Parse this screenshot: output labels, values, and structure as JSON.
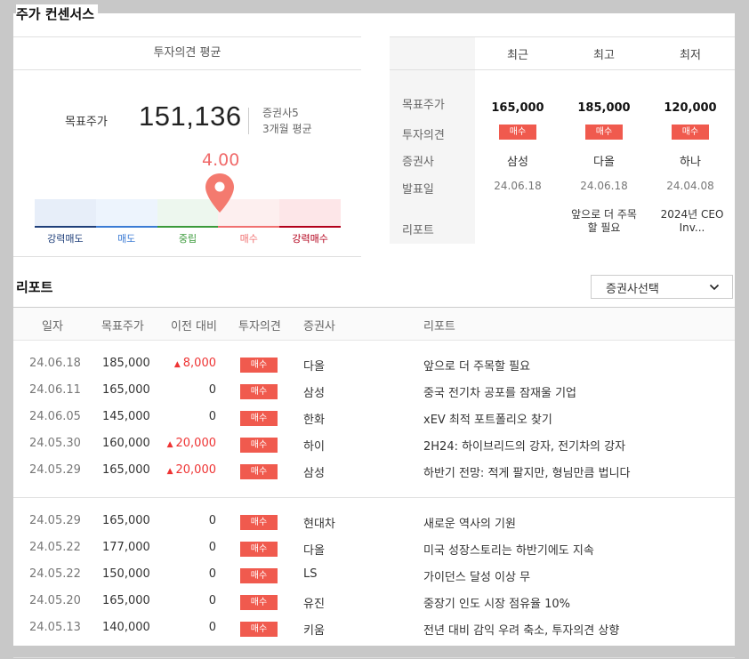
{
  "title": "주가 컨센서스",
  "consensus": {
    "header": "투자의견 평균",
    "target_label": "목표주가",
    "target_value": "151,136",
    "brokers": "증권사5",
    "period": "3개월 평균",
    "score": "4.00",
    "scale": [
      {
        "label": "강력매도",
        "color": "#1f3f7a",
        "bg": "#e7eef9",
        "line": "#1f3f7a"
      },
      {
        "label": "매도",
        "color": "#3b7bd4",
        "bg": "#edf4fd",
        "line": "#3b7bd4"
      },
      {
        "label": "중립",
        "color": "#3a9a3a",
        "bg": "#edf7ee",
        "line": "#3a9a3a"
      },
      {
        "label": "매수",
        "color": "#f07070",
        "bg": "#fdefef",
        "line": "#f07070"
      },
      {
        "label": "강력매수",
        "color": "#b3001b",
        "bg": "#fde6e8",
        "line": "#b3001b"
      }
    ],
    "pin_color": "#f47a6f"
  },
  "summary": {
    "columns": [
      "최근",
      "최고",
      "최저"
    ],
    "row_labels": [
      "목표주가",
      "투자의견",
      "증권사",
      "발표일",
      "리포트"
    ],
    "cells": [
      {
        "price": "165,000",
        "opinion": "매수",
        "broker": "삼성",
        "date": "24.06.18",
        "report": ""
      },
      {
        "price": "185,000",
        "opinion": "매수",
        "broker": "다올",
        "date": "24.06.18",
        "report": "앞으로 더 주목할 필요"
      },
      {
        "price": "120,000",
        "opinion": "매수",
        "broker": "하나",
        "date": "24.04.08",
        "report": "2024년 CEO Inv..."
      }
    ]
  },
  "reports": {
    "title": "리포트",
    "select_label": "증권사선택",
    "columns": [
      "일자",
      "목표주가",
      "이전 대비",
      "투자의견",
      "증권사",
      "리포트"
    ],
    "rows": [
      {
        "date": "24.06.18",
        "price": "185,000",
        "diff": "8,000",
        "up": true,
        "opinion": "매수",
        "broker": "다올",
        "title": "앞으로 더 주목할 필요"
      },
      {
        "date": "24.06.11",
        "price": "165,000",
        "diff": "0",
        "up": false,
        "opinion": "매수",
        "broker": "삼성",
        "title": "중국 전기차 공포를 잠재울 기업"
      },
      {
        "date": "24.06.05",
        "price": "145,000",
        "diff": "0",
        "up": false,
        "opinion": "매수",
        "broker": "한화",
        "title": "xEV 최적 포트폴리오 찾기"
      },
      {
        "date": "24.05.30",
        "price": "160,000",
        "diff": "20,000",
        "up": true,
        "opinion": "매수",
        "broker": "하이",
        "title": "2H24: 하이브리드의 강자, 전기차의 강자"
      },
      {
        "date": "24.05.29",
        "price": "165,000",
        "diff": "20,000",
        "up": true,
        "opinion": "매수",
        "broker": "삼성",
        "title": "하반기 전망: 적게 팔지만, 형님만큼 법니다"
      },
      {
        "date": "24.05.29",
        "price": "165,000",
        "diff": "0",
        "up": false,
        "opinion": "매수",
        "broker": "현대차",
        "title": "새로운 역사의 기원"
      },
      {
        "date": "24.05.22",
        "price": "177,000",
        "diff": "0",
        "up": false,
        "opinion": "매수",
        "broker": "다올",
        "title": "미국 성장스토리는 하반기에도 지속"
      },
      {
        "date": "24.05.22",
        "price": "150,000",
        "diff": "0",
        "up": false,
        "opinion": "매수",
        "broker": "LS",
        "title": "가이던스 달성 이상 무"
      },
      {
        "date": "24.05.20",
        "price": "165,000",
        "diff": "0",
        "up": false,
        "opinion": "매수",
        "broker": "유진",
        "title": "중장기 인도 시장 점유율 10%"
      },
      {
        "date": "24.05.13",
        "price": "140,000",
        "diff": "0",
        "up": false,
        "opinion": "매수",
        "broker": "키움",
        "title": "전년 대비 감익 우려 축소, 투자의견 상향"
      }
    ]
  }
}
